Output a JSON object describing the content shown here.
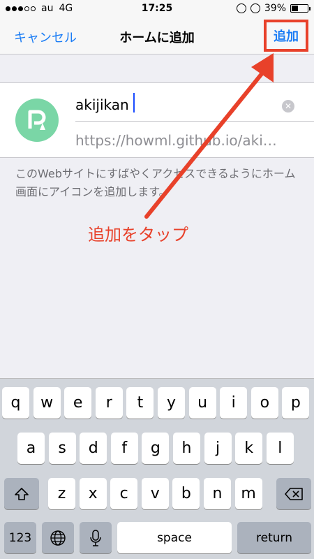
{
  "status_bar": {
    "carrier": "au",
    "network": "4G",
    "time": "17:25",
    "battery_percent": "39%",
    "battery_level": 0.39
  },
  "nav": {
    "cancel_label": "キャンセル",
    "title": "ホームに追加",
    "add_label": "追加"
  },
  "card": {
    "icon": "site-logo-icon",
    "name_value": "akijikan",
    "url": "https://howml.github.io/aki…"
  },
  "description": "このWebサイトにすばやくアクセスできるようにホーム画面にアイコンを追加します。",
  "annotation": "追加をタップ",
  "colors": {
    "accent": "#1a7cf5",
    "annotation": "#e8412a",
    "icon_bg": "#7ad6a6"
  },
  "keyboard": {
    "row1": [
      "q",
      "w",
      "e",
      "r",
      "t",
      "y",
      "u",
      "i",
      "o",
      "p"
    ],
    "row2": [
      "a",
      "s",
      "d",
      "f",
      "g",
      "h",
      "j",
      "k",
      "l"
    ],
    "row3": [
      "z",
      "x",
      "c",
      "v",
      "b",
      "n",
      "m"
    ],
    "shift_icon": "shift-icon",
    "backspace_icon": "backspace-icon",
    "numbers_label": "123",
    "globe_icon": "globe-icon",
    "mic_icon": "microphone-icon",
    "space_label": "space",
    "return_label": "return"
  }
}
